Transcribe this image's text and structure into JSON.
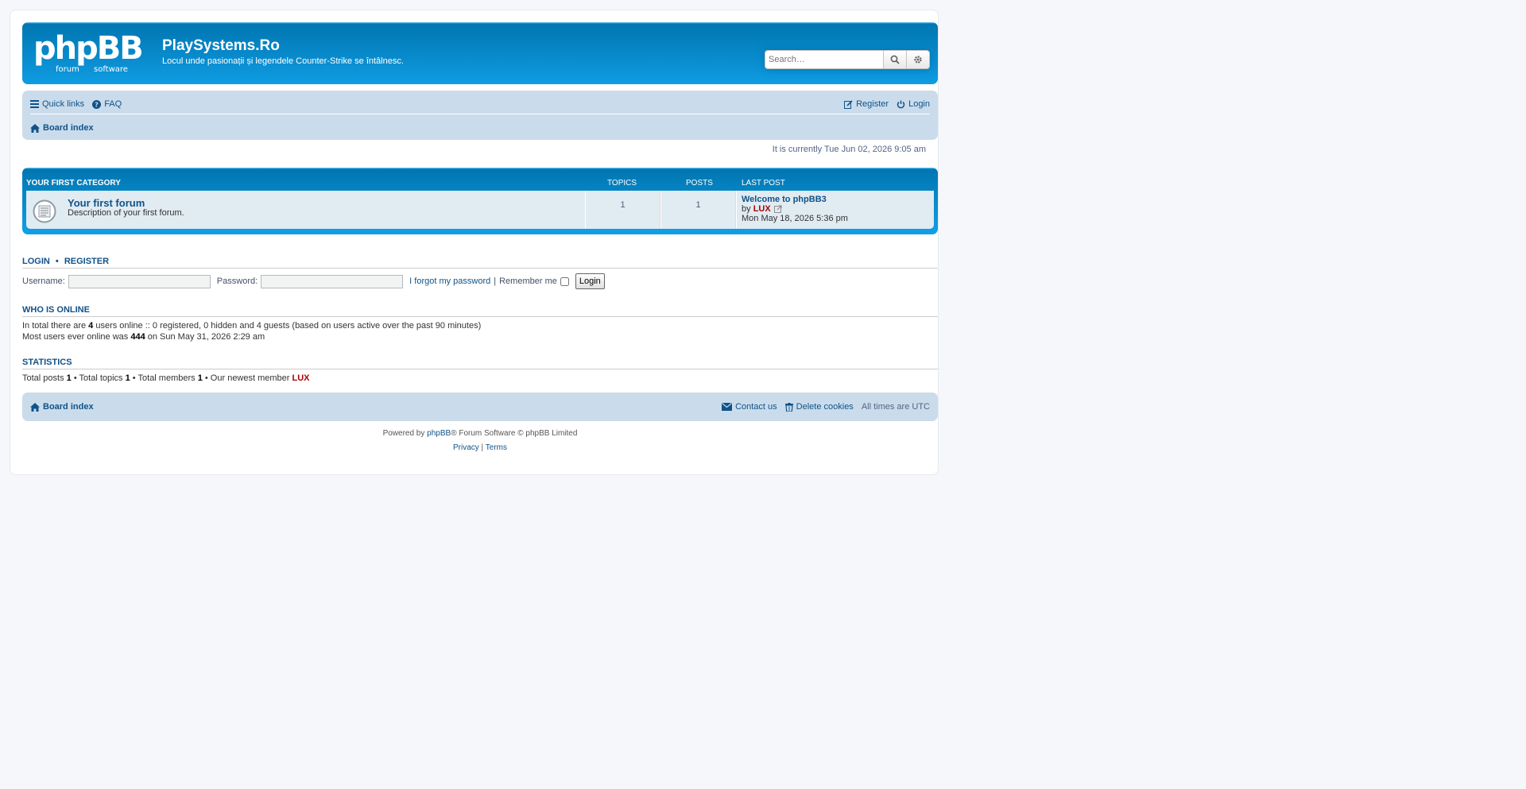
{
  "header": {
    "site_title": "PlaySystems.Ro",
    "site_description": "Locul unde pasionații și legendele Counter-Strike se întâlnesc.",
    "search_placeholder": "Search…",
    "logo_text": "phpBB",
    "logo_sub_left": "forum",
    "logo_sub_right": "software",
    "search_icon": "search-icon",
    "advanced_search_icon": "gear-icon"
  },
  "navbar": {
    "quick_links": "Quick links",
    "faq": "FAQ",
    "register": "Register",
    "login": "Login",
    "board_index": "Board index"
  },
  "current_time": "It is currently Tue Jun 02, 2026 9:05 am",
  "category": {
    "name": "Your first category",
    "col_topics": "Topics",
    "col_posts": "Posts",
    "col_last_post": "Last post",
    "forums": [
      {
        "title": "Your first forum",
        "description": "Description of your first forum.",
        "topics": "1",
        "posts": "1",
        "last_post_title": "Welcome to phpBB3",
        "last_post_by": "by",
        "last_post_author": "LUX",
        "last_post_date": "Mon May 18, 2026 5:36 pm"
      }
    ]
  },
  "login_section": {
    "title_login": "Login",
    "separator": "•",
    "title_register": "Register",
    "username_label": "Username:",
    "password_label": "Password:",
    "forgot_password": "I forgot my password",
    "pipe": "|",
    "remember_me": "Remember me",
    "login_button": "Login"
  },
  "who_is_online": {
    "title": "Who is online",
    "line1_a": "In total there are ",
    "line1_total": "4",
    "line1_b": " users online :: 0 registered, 0 hidden and 4 guests (based on users active over the past 90 minutes)",
    "line2_a": "Most users ever online was ",
    "line2_max": "444",
    "line2_b": " on Sun May 31, 2026 2:29 am"
  },
  "statistics": {
    "title": "Statistics",
    "posts_label": "Total posts ",
    "posts": "1",
    "topics_label": " • Total topics ",
    "topics": "1",
    "members_label": " • Total members ",
    "members": "1",
    "newest_label": " • Our newest member ",
    "newest_member": "LUX"
  },
  "footer": {
    "board_index": "Board index",
    "contact_us": "Contact us",
    "delete_cookies": "Delete cookies",
    "timezone_label": "All times are ",
    "timezone": "UTC",
    "powered_by": "Powered by ",
    "phpbb_link": "phpBB",
    "powered_suffix": "® Forum Software © phpBB Limited",
    "privacy": "Privacy",
    "pipe": " | ",
    "terms": "Terms"
  },
  "colors": {
    "header_blue": "#12a3eb",
    "navbar_bg": "#cadceb",
    "forum_row_bg": "#e1ebf2",
    "link": "#105289",
    "admin_red": "#aa0000"
  }
}
